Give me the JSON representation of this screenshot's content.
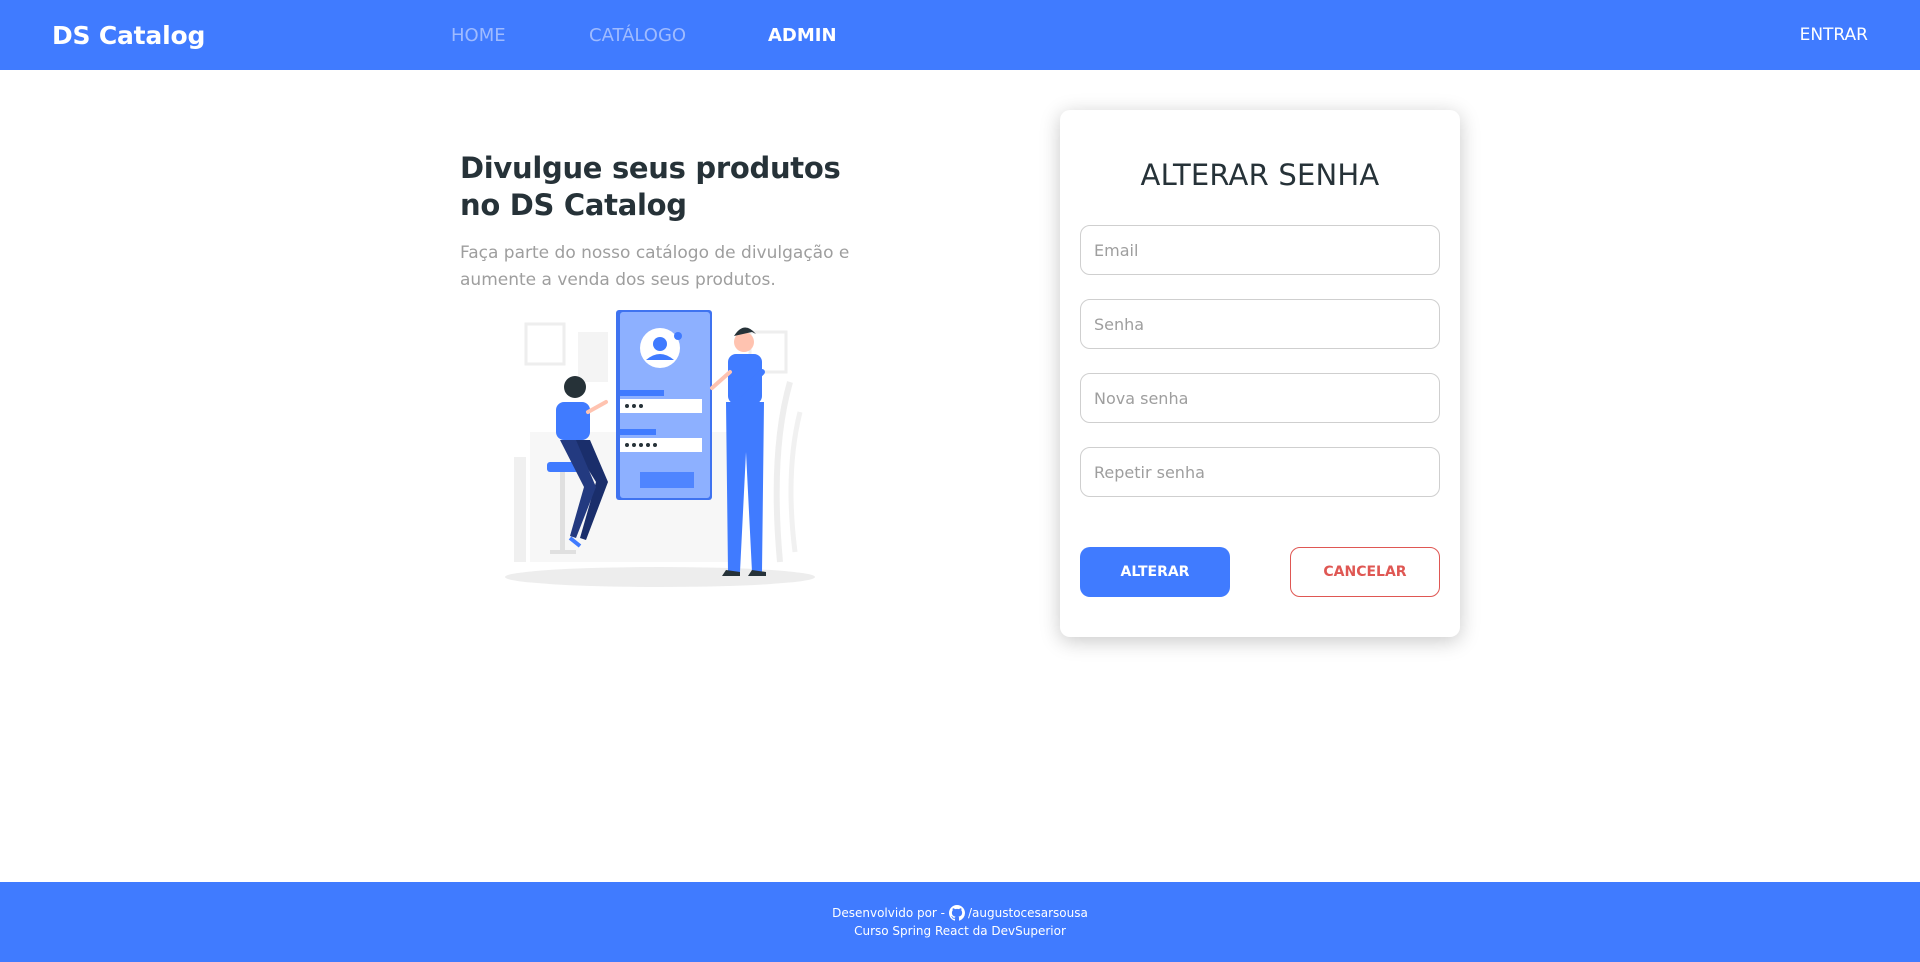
{
  "navbar": {
    "brand": "DS Catalog",
    "links": [
      {
        "label": "HOME",
        "active": false
      },
      {
        "label": "CATÁLOGO",
        "active": false
      },
      {
        "label": "ADMIN",
        "active": true
      }
    ],
    "login": "ENTRAR"
  },
  "hero": {
    "title": "Divulgue seus produtos no DS Catalog",
    "subtitle": "Faça parte do nosso catálogo de divulgação e aumente a venda dos seus produtos.",
    "illustration": "login-illustration"
  },
  "form": {
    "title": "ALTERAR SENHA",
    "email_placeholder": "Email",
    "password_placeholder": "Senha",
    "new_password_placeholder": "Nova senha",
    "repeat_password_placeholder": "Repetir senha",
    "submit_label": "ALTERAR",
    "cancel_label": "CANCELAR"
  },
  "footer": {
    "developed_by": "Desenvolvido por -",
    "github_icon": "github-icon",
    "github_user": "/augustocesarsousa",
    "course": "Curso Spring React da DevSuperior"
  },
  "colors": {
    "primary": "#407bff",
    "danger": "#df5753",
    "text_dark": "#263238",
    "text_muted": "#9e9e9e"
  }
}
